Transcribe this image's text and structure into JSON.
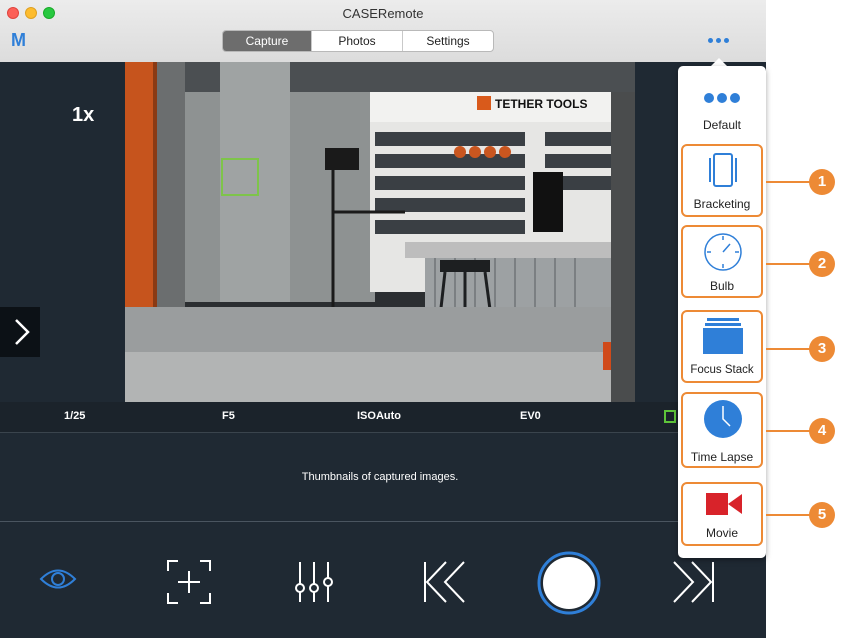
{
  "window": {
    "title": "CASERemote",
    "logo": "M"
  },
  "tabs": [
    {
      "label": "Capture",
      "active": true
    },
    {
      "label": "Photos",
      "active": false
    },
    {
      "label": "Settings",
      "active": false
    }
  ],
  "liveview": {
    "zoom": "1x",
    "next_icon": "chevron-right-icon",
    "storefront_sign": "TETHER TOOLS"
  },
  "exposure": {
    "shutter": "1/25",
    "aperture": "F5",
    "iso": "ISOAuto",
    "ev": "EV0"
  },
  "thumbnails": {
    "text": "Thumbnails of captured images."
  },
  "toolbar": {
    "icons": [
      "eye-icon",
      "focus-icon",
      "sliders-icon",
      "rewind-icon",
      "shutter-icon",
      "skip-forward-icon"
    ]
  },
  "menu": {
    "items": [
      {
        "label": "Default",
        "icon": "three-dots-icon"
      },
      {
        "label": "Bracketing",
        "icon": "bracketing-icon",
        "callout": "1"
      },
      {
        "label": "Bulb",
        "icon": "dial-icon",
        "callout": "2"
      },
      {
        "label": "Focus Stack",
        "icon": "focus-stack-icon",
        "callout": "3"
      },
      {
        "label": "Time Lapse",
        "icon": "clock-icon",
        "callout": "4"
      },
      {
        "label": "Movie",
        "icon": "movie-camera-icon",
        "callout": "5"
      }
    ]
  },
  "colors": {
    "accent": "#2f7fd8",
    "callout": "#ed8a35",
    "movie": "#d8232a",
    "af_box": "#7ec44a",
    "background": "#1f2933"
  }
}
